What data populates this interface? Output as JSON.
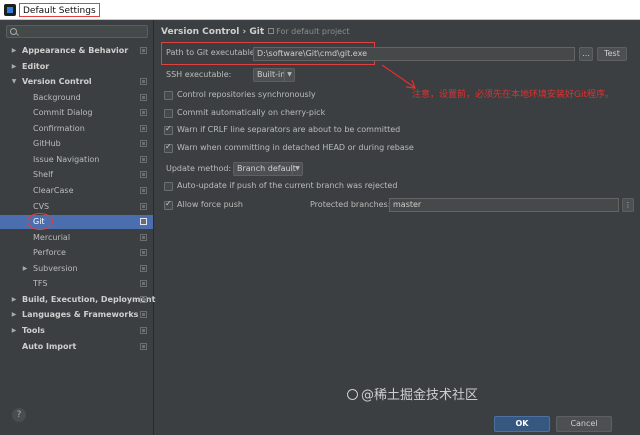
{
  "window": {
    "title": "Default Settings"
  },
  "sidebar": {
    "search_placeholder": "",
    "items": [
      {
        "label": "Appearance & Behavior",
        "expanded": false
      },
      {
        "label": "Editor",
        "expanded": false
      },
      {
        "label": "Version Control",
        "expanded": true
      },
      {
        "label": "Background"
      },
      {
        "label": "Commit Dialog"
      },
      {
        "label": "Confirmation"
      },
      {
        "label": "GitHub"
      },
      {
        "label": "Issue Navigation"
      },
      {
        "label": "Shelf"
      },
      {
        "label": "ClearCase"
      },
      {
        "label": "CVS"
      },
      {
        "label": "Git",
        "selected": true
      },
      {
        "label": "Mercurial"
      },
      {
        "label": "Perforce"
      },
      {
        "label": "Subversion",
        "expanded": false
      },
      {
        "label": "TFS"
      },
      {
        "label": "Build, Execution, Deployment",
        "expanded": false
      },
      {
        "label": "Languages & Frameworks",
        "expanded": false
      },
      {
        "label": "Tools",
        "expanded": false
      },
      {
        "label": "Auto Import"
      }
    ],
    "help": "?"
  },
  "main": {
    "breadcrumb": {
      "path": "Version Control › Git",
      "scope": "For default project"
    },
    "path_to_git": {
      "label": "Path to Git executable:",
      "value": "D:\\software\\Git\\cmd\\git.exe",
      "browse": "...",
      "test": "Test"
    },
    "ssh": {
      "label": "SSH executable:",
      "value": "Built-in"
    },
    "options": {
      "control_repos": {
        "label": "Control repositories synchronously",
        "checked": false
      },
      "cherry_pick": {
        "label": "Commit automatically on cherry-pick",
        "checked": false
      },
      "crlf": {
        "label": "Warn if CRLF line separators are about to be committed",
        "checked": true
      },
      "detached": {
        "label": "Warn when committing in detached HEAD or during rebase",
        "checked": true
      }
    },
    "update_method": {
      "label": "Update method:",
      "value": "Branch default"
    },
    "auto_update": {
      "label": "Auto-update if push of the current branch was rejected",
      "checked": false
    },
    "force_push": {
      "label": "Allow force push",
      "checked": true
    },
    "protected_branches": {
      "label": "Protected branches:",
      "value": "master"
    },
    "annotation": "注意，设置前，必须先在本地环境安装好Git程序。",
    "footer": {
      "ok": "OK",
      "cancel": "Cancel"
    }
  },
  "watermark": "@稀土掘金技术社区",
  "colors": {
    "accent": "#4b6eaf",
    "annotation": "#e03030",
    "background": "#3c3f41"
  }
}
